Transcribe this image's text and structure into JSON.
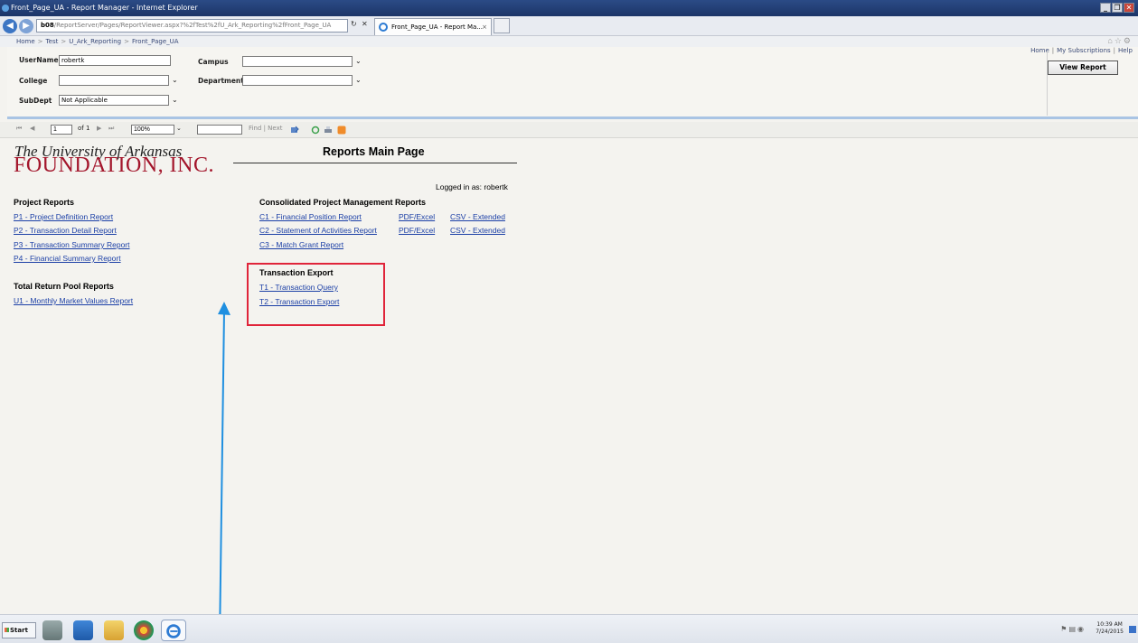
{
  "window": {
    "title": "Front_Page_UA - Report Manager - Internet Explorer",
    "address_host": "b08",
    "address_rest": "/ReportServer/Pages/ReportViewer.aspx?%2fTest%2fU_Ark_Reporting%2fFront_Page_UA",
    "tab_label": "Front_Page_UA - Report Ma...",
    "minimize": "_",
    "restore": "❐",
    "close": "✕"
  },
  "breadcrumb": [
    "Home",
    "Test",
    "U_Ark_Reporting",
    "Front_Page_UA"
  ],
  "breadcrumb_sep": ">",
  "top_links": {
    "home": "Home",
    "subscriptions": "My Subscriptions",
    "help": "Help",
    "sep": "|"
  },
  "params": {
    "username_label": "UserName",
    "username_value": "robertk",
    "campus_label": "Campus",
    "campus_value": "",
    "college_label": "College",
    "college_value": "",
    "department_label": "Department",
    "department_value": "",
    "subdept_label": "SubDept",
    "subdept_value": "Not Applicable",
    "view_report": "View Report"
  },
  "toolbar": {
    "page_value": "1",
    "of_label": "of 1",
    "zoom_value": "100%",
    "find_label": "Find",
    "find_sep": "|",
    "next_label": "Next"
  },
  "report": {
    "logo_line1": "The University of Arkansas",
    "logo_line2": "FOUNDATION, INC.",
    "title": "Reports Main Page",
    "logged_in": "Logged in as:  robertk",
    "project_reports": {
      "heading": "Project Reports",
      "links": [
        "P1 - Project Definition Report",
        "P2 - Transaction Detail Report",
        "P3 - Transaction Summary Report",
        "P4 - Financial Summary Report"
      ]
    },
    "total_return": {
      "heading": "Total Return Pool Reports",
      "links": [
        "U1 - Monthly Market Values Report"
      ]
    },
    "consolidated": {
      "heading": "Consolidated Project Management Reports",
      "rows": [
        {
          "report": "C1 - Financial Position Report",
          "pdf": "PDF/Excel",
          "csv": "CSV - Extended"
        },
        {
          "report": "C2 - Statement of Activities Report",
          "pdf": "PDF/Excel",
          "csv": "CSV - Extended"
        },
        {
          "report": "C3 - Match Grant Report"
        }
      ]
    },
    "transaction_export": {
      "heading": "Transaction Export",
      "links": [
        "T1 - Transaction Query",
        "T2 - Transaction Export"
      ]
    }
  },
  "colors": {
    "link": "#1b3fa6",
    "logo_red": "#a3152b",
    "highlight_box": "#e0243a",
    "annotation_arrow": "#1f8fe0"
  },
  "taskbar": {
    "start": "Start",
    "time": "10:39 AM",
    "date": "7/24/2015"
  }
}
